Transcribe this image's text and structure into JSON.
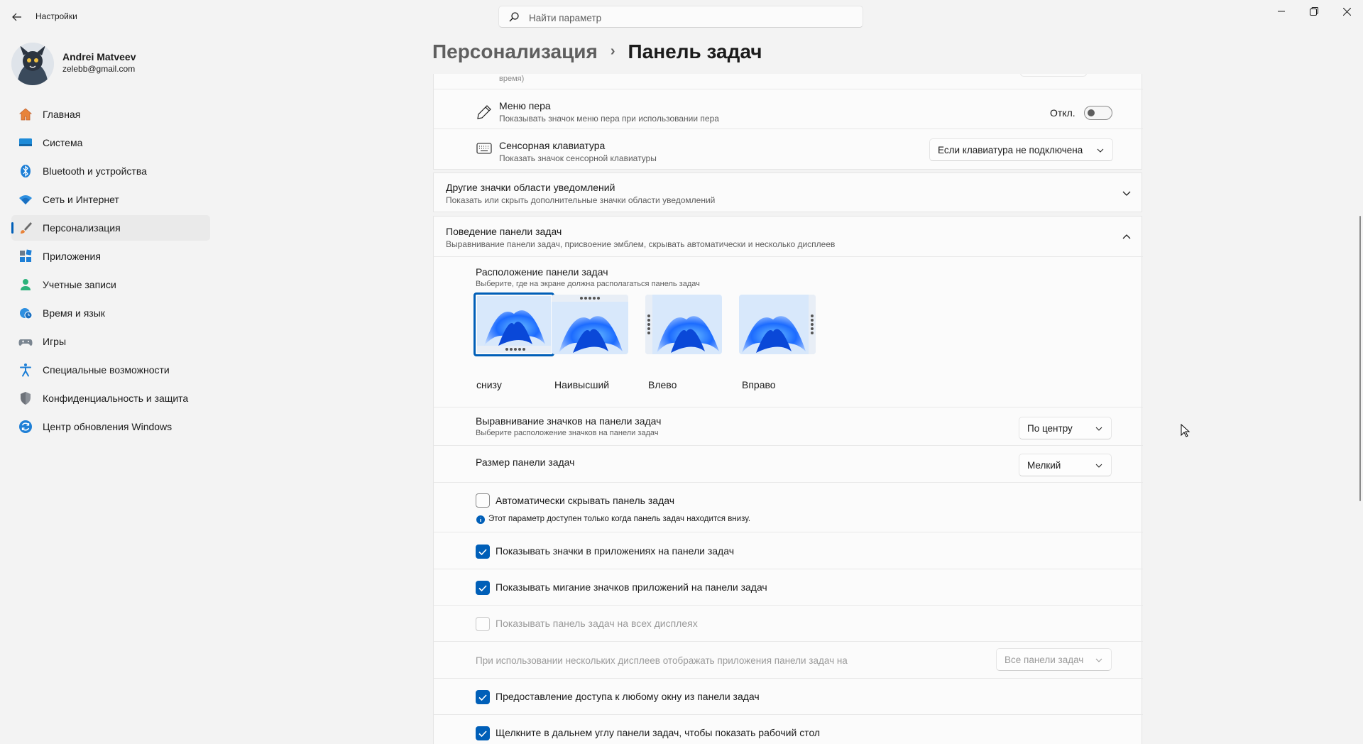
{
  "app": {
    "title": "Настройки"
  },
  "search": {
    "placeholder": "Найти параметр"
  },
  "user": {
    "name": "Andrei Matveev",
    "email": "zelebb@gmail.com"
  },
  "nav": [
    {
      "label": "Главная",
      "icon": "home-icon"
    },
    {
      "label": "Система",
      "icon": "system-icon"
    },
    {
      "label": "Bluetooth и устройства",
      "icon": "bluetooth-icon"
    },
    {
      "label": "Сеть и Интернет",
      "icon": "wifi-icon"
    },
    {
      "label": "Персонализация",
      "icon": "brush-icon",
      "active": true
    },
    {
      "label": "Приложения",
      "icon": "apps-icon"
    },
    {
      "label": "Учетные записи",
      "icon": "account-icon"
    },
    {
      "label": "Время и язык",
      "icon": "clock-globe-icon"
    },
    {
      "label": "Игры",
      "icon": "gamepad-icon"
    },
    {
      "label": "Специальные возможности",
      "icon": "accessibility-icon"
    },
    {
      "label": "Конфиденциальность и защита",
      "icon": "shield-icon"
    },
    {
      "label": "Центр обновления Windows",
      "icon": "update-icon"
    }
  ],
  "breadcrumb": {
    "parent": "Персонализация",
    "separator": "›",
    "current": "Панель задач"
  },
  "tray": {
    "partial_sub": "время)",
    "pen": {
      "title": "Меню пера",
      "sub": "Показывать значок меню пера при использовании пера",
      "state": "Откл."
    },
    "touch": {
      "title": "Сенсорная клавиатура",
      "sub": "Показать значок сенсорной клавиатуры",
      "value": "Если клавиатура не подключена"
    }
  },
  "other_icons": {
    "title": "Другие значки области уведомлений",
    "sub": "Показать или скрыть дополнительные значки области уведомлений"
  },
  "behavior": {
    "title": "Поведение панели задач",
    "sub": "Выравнивание панели задач, присвоение эмблем, скрывать автоматически и несколько дисплеев",
    "location": {
      "title": "Расположение панели задач",
      "sub": "Выберите, где на экране должна располагаться панель задач",
      "options": [
        "снизу",
        "Наивысший",
        "Влево",
        "Вправо"
      ],
      "selected": "снизу"
    },
    "alignment": {
      "title": "Выравнивание значков на панели задач",
      "sub": "Выберите расположение значков на панели задач",
      "value": "По центру"
    },
    "size": {
      "title": "Размер панели задач",
      "value": "Мелкий"
    },
    "autohide": {
      "label": "Автоматически скрывать панель задач",
      "checked": false,
      "note": "Этот параметр доступен только когда панель задач находится внизу."
    },
    "badges": {
      "label": "Показывать значки в приложениях на панели задач",
      "checked": true
    },
    "flashing": {
      "label": "Показывать мигание значков приложений на панели задач",
      "checked": true
    },
    "all_displays": {
      "label": "Показывать панель задач на всех дисплеях",
      "checked": false,
      "disabled": true
    },
    "multi_display": {
      "label": "При использовании нескольких дисплеев отображать приложения панели задач на",
      "value": "Все панели задач",
      "disabled": true
    },
    "share_window": {
      "label": "Предоставление доступа к любому окну из панели задач",
      "checked": true
    },
    "far_corner": {
      "label": "Щелкните в дальнем углу панели задач, чтобы показать рабочий стол",
      "checked": true
    }
  },
  "colors": {
    "accent": "#005fb8",
    "background": "#f3f3f3",
    "card": "#fbfbfb"
  }
}
